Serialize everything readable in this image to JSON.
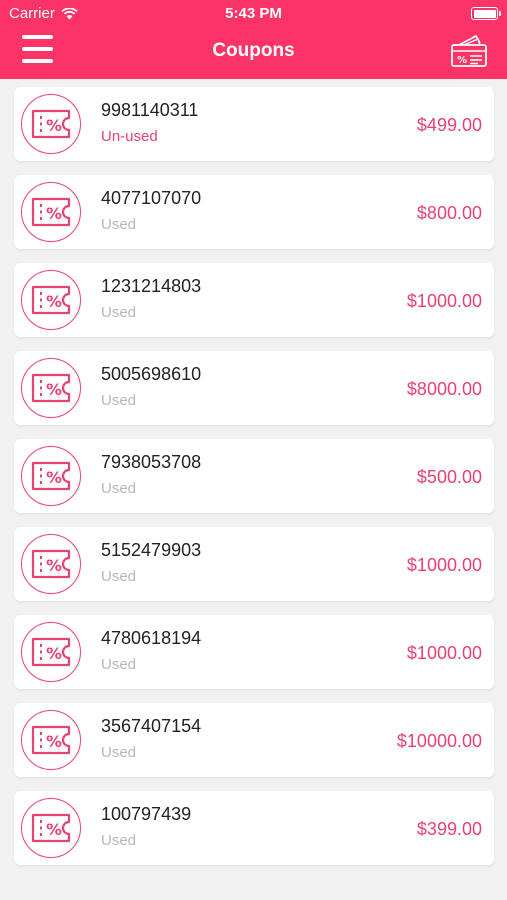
{
  "status_bar": {
    "carrier": "Carrier",
    "time": "5:43 PM"
  },
  "nav": {
    "title": "Coupons",
    "menu_icon": "hamburger-menu-icon",
    "right_icon": "coupon-card-icon"
  },
  "colors": {
    "brand": "#fc3366",
    "accent": "#e8436e",
    "muted": "#b8b8b8"
  },
  "coupons": [
    {
      "code": "9981140311",
      "status": "Un-used",
      "amount": "$499.00"
    },
    {
      "code": "4077107070",
      "status": "Used",
      "amount": "$800.00"
    },
    {
      "code": "1231214803",
      "status": "Used",
      "amount": "$1000.00"
    },
    {
      "code": "5005698610",
      "status": "Used",
      "amount": "$8000.00"
    },
    {
      "code": "7938053708",
      "status": "Used",
      "amount": "$500.00"
    },
    {
      "code": "5152479903",
      "status": "Used",
      "amount": "$1000.00"
    },
    {
      "code": "4780618194",
      "status": "Used",
      "amount": "$1000.00"
    },
    {
      "code": "3567407154",
      "status": "Used",
      "amount": "$10000.00"
    },
    {
      "code": "100797439",
      "status": "Used",
      "amount": "$399.00"
    }
  ]
}
